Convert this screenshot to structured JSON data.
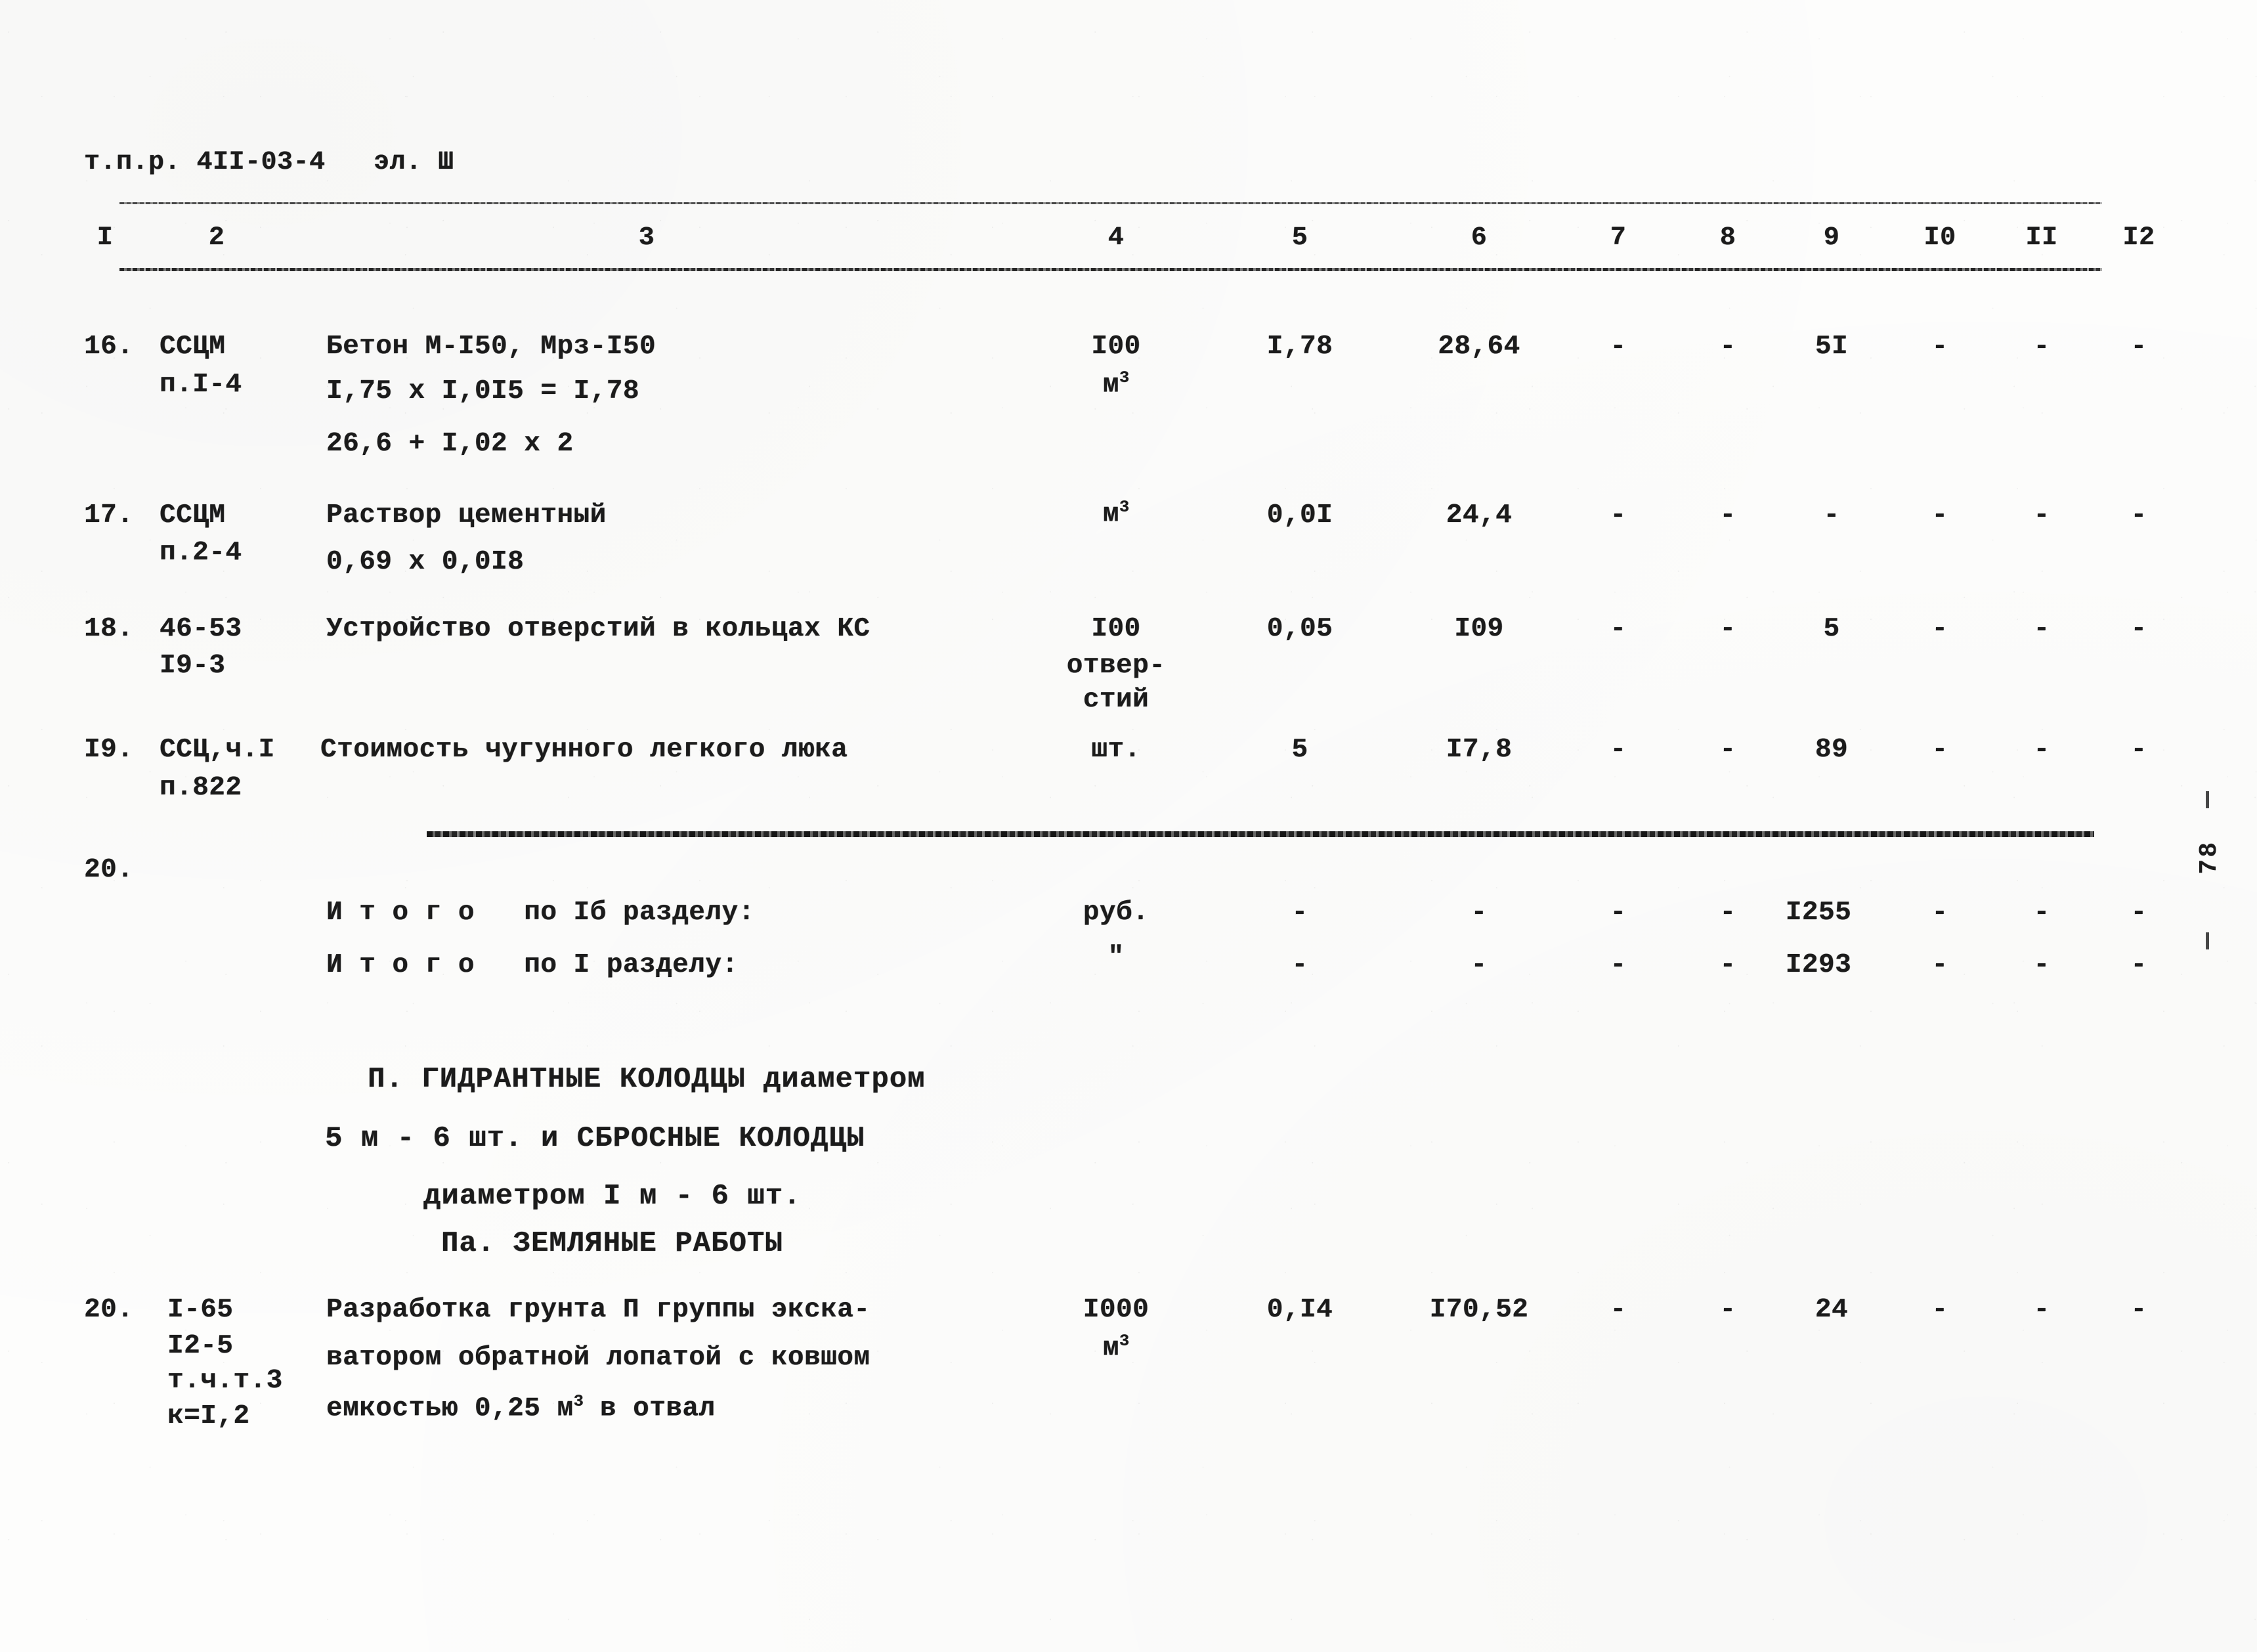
{
  "document": {
    "header_code": "т.п.р. 4II-03-4   эл. Ш",
    "page_number": "78"
  },
  "table": {
    "column_numbers": [
      "I",
      "2",
      "3",
      "4",
      "5",
      "6",
      "7",
      "8",
      "9",
      "I0",
      "II",
      "I2"
    ],
    "dash": "-",
    "rows": [
      {
        "no": "16.",
        "code_lines": [
          "ССЦМ",
          "п.I-4"
        ],
        "description_lines": [
          "Бетон М-I50, Мрз-I50",
          "I,75 х I,0I5 = I,78",
          "26,6 + I,02 х 2"
        ],
        "unit_lines": [
          "I00",
          "м3"
        ],
        "qty": "I,78",
        "price": "28,64",
        "c7": "-",
        "c8": "-",
        "c9": "5I",
        "c10": "-",
        "c11": "-",
        "c12": "-"
      },
      {
        "no": "17.",
        "code_lines": [
          "ССЦМ",
          "п.2-4"
        ],
        "description_lines": [
          "Раствор цементный",
          "0,69 х 0,0I8"
        ],
        "unit_lines": [
          "м3"
        ],
        "qty": "0,0I",
        "price": "24,4",
        "c7": "-",
        "c8": "-",
        "c9": "-",
        "c10": "-",
        "c11": "-",
        "c12": "-"
      },
      {
        "no": "18.",
        "code_lines": [
          "46-53",
          "I9-3"
        ],
        "description_lines": [
          "Устройство отверстий в кольцах КС"
        ],
        "unit_lines": [
          "I00",
          "отвер-",
          "стий"
        ],
        "qty": "0,05",
        "price": "I09",
        "c7": "-",
        "c8": "-",
        "c9": "5",
        "c10": "-",
        "c11": "-",
        "c12": "-"
      },
      {
        "no": "I9.",
        "code_lines": [
          "ССЦ,ч.I",
          "п.822"
        ],
        "description_lines": [
          "Стоимость чугунного легкого люка"
        ],
        "unit_lines": [
          "шт."
        ],
        "qty": "5",
        "price": "I7,8",
        "c7": "-",
        "c8": "-",
        "c9": "89",
        "c10": "-",
        "c11": "-",
        "c12": "-"
      }
    ],
    "row20_marker": "20.",
    "totals": [
      {
        "label": "И т о г о   по Iб разделу:",
        "unit": "руб.",
        "qty": "-",
        "price": "-",
        "c7": "-",
        "c8": "-",
        "c9": "I255",
        "c10": "-",
        "c11": "-",
        "c12": "-"
      },
      {
        "label": "И т о г о   по I разделу:",
        "unit": "\"",
        "qty": "-",
        "price": "-",
        "c7": "-",
        "c8": "-",
        "c9": "I293",
        "c10": "-",
        "c11": "-",
        "c12": "-"
      }
    ],
    "section_heading": [
      "П. ГИДРАНТНЫЕ КОЛОДЦЫ диаметром",
      "5 м - 6 шт. и СБРОСНЫЕ КОЛОДЦЫ",
      "диаметром I м - 6 шт."
    ],
    "subsection_heading": "Па. ЗЕМЛЯНЫЕ РАБОТЫ",
    "last_row": {
      "no": "20.",
      "code_lines": [
        "I-65",
        "I2-5",
        "т.ч.т.3",
        "к=I,2"
      ],
      "description_lines": [
        "Разработка грунта П группы экска-",
        "ватором обратной лопатой с ковшом",
        "емкостью 0,25 м3 в отвал"
      ],
      "unit_lines": [
        "I000",
        "м3"
      ],
      "qty": "0,I4",
      "price": "I70,52",
      "c7": "-",
      "c8": "-",
      "c9": "24",
      "c10": "-",
      "c11": "-",
      "c12": "-"
    }
  }
}
